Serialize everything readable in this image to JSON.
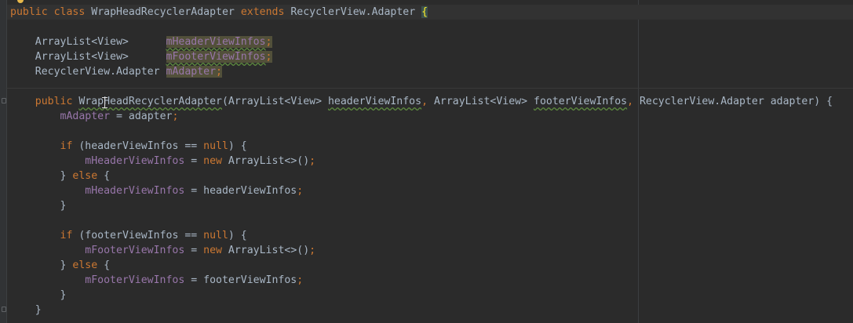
{
  "code": {
    "class_decl": {
      "kw_public": "public",
      "kw_class": "class",
      "class_name": "WrapHeadRecyclerAdapter",
      "kw_extends": "extends",
      "parent": "RecyclerView.Adapter",
      "open_brace": "{"
    },
    "fields": [
      {
        "type": "ArrayList<View>",
        "pad": "      ",
        "name": "mHeaderViewInfos",
        "semi": ";"
      },
      {
        "type": "ArrayList<View>",
        "pad": "      ",
        "name": "mFooterViewInfos",
        "semi": ";"
      },
      {
        "type": "RecyclerView.Adapter",
        "pad": " ",
        "name": "mAdapter",
        "semi": ";"
      }
    ],
    "ctor": {
      "kw_public": "public",
      "name": "WrapHeadRecyclerAdapter",
      "p1": "(ArrayList<View> ",
      "p1_name": "headerViewInfos",
      "comma1": ", ",
      "p2": "ArrayList<View> ",
      "p2_name": "footerViewInfos",
      "comma2": ", ",
      "p3": "RecyclerView.Adapter adapter) {"
    },
    "assign_adapter": {
      "field": "mAdapter",
      "rest": " = adapter",
      "semi": ";"
    },
    "header_block": {
      "kw_if": "if",
      "cond_a": " (headerViewInfos == ",
      "kw_null": "null",
      "cond_b": ") {",
      "field1": "mHeaderViewInfos",
      "eq": " = ",
      "kw_new": "new",
      "new_rest": " ArrayList<>()",
      "semi": ";",
      "else_a": "} ",
      "kw_else": "else",
      "else_b": " {",
      "field2": "mHeaderViewInfos",
      "assign_rest": " = headerViewInfos",
      "close": "}"
    },
    "footer_block": {
      "kw_if": "if",
      "cond_a": " (footerViewInfos == ",
      "kw_null": "null",
      "cond_b": ") {",
      "field1": "mFooterViewInfos",
      "eq": " = ",
      "kw_new": "new",
      "new_rest": " ArrayList<>()",
      "semi": ";",
      "else_a": "} ",
      "kw_else": "else",
      "else_b": " {",
      "field2": "mFooterViewInfos",
      "assign_rest": " = footerViewInfos",
      "close": "}"
    },
    "ctor_close": "}"
  },
  "colors": {
    "background": "#2b2b2b",
    "keyword": "#cc7832",
    "field": "#9876aa",
    "text": "#a9b7c6",
    "usage_highlight": "#52503a"
  },
  "icons": {
    "bulb": "lightbulb-icon",
    "fold": "fold-marker-icon",
    "cursor": "ibeam-cursor-icon"
  }
}
